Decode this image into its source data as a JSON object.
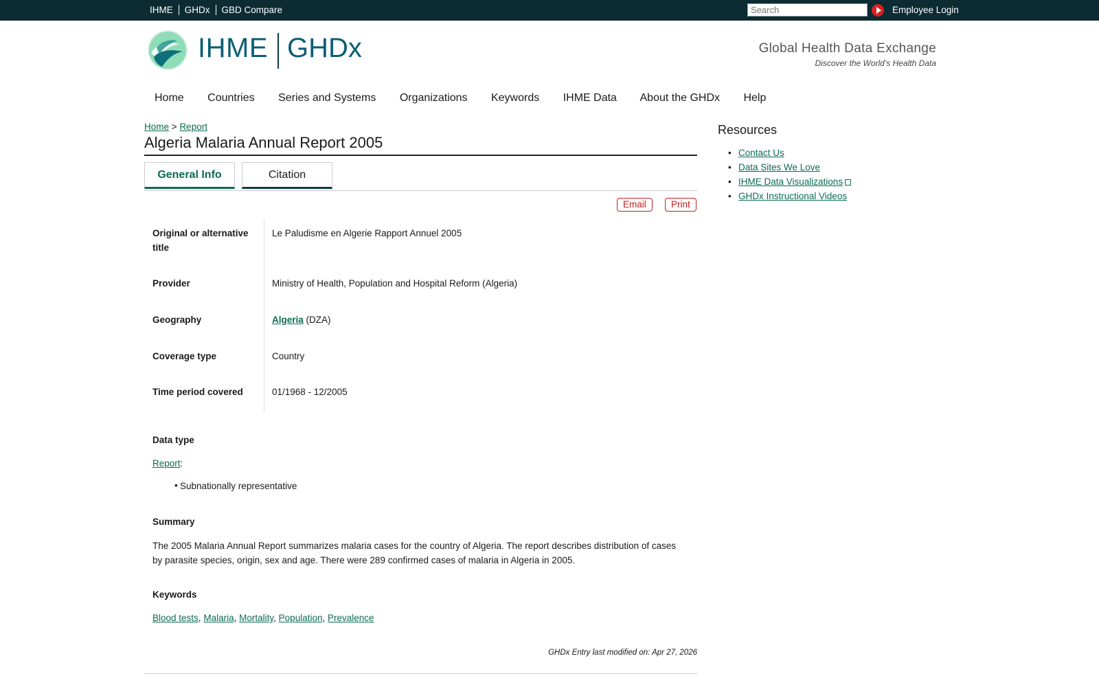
{
  "topbar": {
    "links": [
      "IHME",
      "GHDx",
      "GBD Compare"
    ],
    "search_placeholder": "Search",
    "login": "Employee Login"
  },
  "header": {
    "logo_left": "IHME",
    "logo_right": "GHDx",
    "tagline": "Global Health Data Exchange",
    "tagline_sub": "Discover the World’s Health Data"
  },
  "nav": [
    "Home",
    "Countries",
    "Series and Systems",
    "Organizations",
    "Keywords",
    "IHME Data",
    "About the GHDx",
    "Help"
  ],
  "breadcrumb": {
    "home": "Home",
    "sep": ">",
    "current": "Report"
  },
  "page": {
    "title": "Algeria Malaria Annual Report 2005",
    "tabs": [
      "General Info",
      "Citation"
    ],
    "email": "Email",
    "print": "Print"
  },
  "info": {
    "rows": [
      {
        "label": "Original or alternative title",
        "value": "Le Paludisme en Algerie Rapport Annuel 2005"
      },
      {
        "label": "Provider",
        "value": "Ministry of Health, Population and Hospital Reform (Algeria)"
      },
      {
        "label": "Geography",
        "link": "Algeria",
        "value": "(DZA)"
      },
      {
        "label": "Coverage type",
        "value": "Country"
      },
      {
        "label": "Time period covered",
        "value": "01/1968 - 12/2005"
      }
    ],
    "data_type_heading": "Data type",
    "data_type_link": "Report",
    "data_type_colon": ":",
    "data_type_bullet": "Subnationally representative",
    "summary_heading": "Summary",
    "summary_text": "The 2005 Malaria Annual Report summarizes malaria cases for the country of Algeria. The report describes distribution of cases by parasite species, origin, sex and age. There were 289 confirmed cases of malaria in Algeria in 2005.",
    "keywords_heading": "Keywords",
    "keywords": [
      "Blood tests",
      "Malaria",
      "Mortality",
      "Population",
      "Prevalence"
    ],
    "keyword_sep": ",",
    "modified": "GHDx Entry last modified on: Apr 27, 2026"
  },
  "sidebar": {
    "title": "Resources",
    "items": [
      "Contact Us",
      "Data Sites We Love",
      "IHME Data Visualizations",
      "GHDx Instructional Videos"
    ]
  },
  "colors": {
    "topbar": "#0c2b33",
    "link": "#0b6b52",
    "accent_red": "#c21f1f",
    "logo": "#0c5e74"
  }
}
